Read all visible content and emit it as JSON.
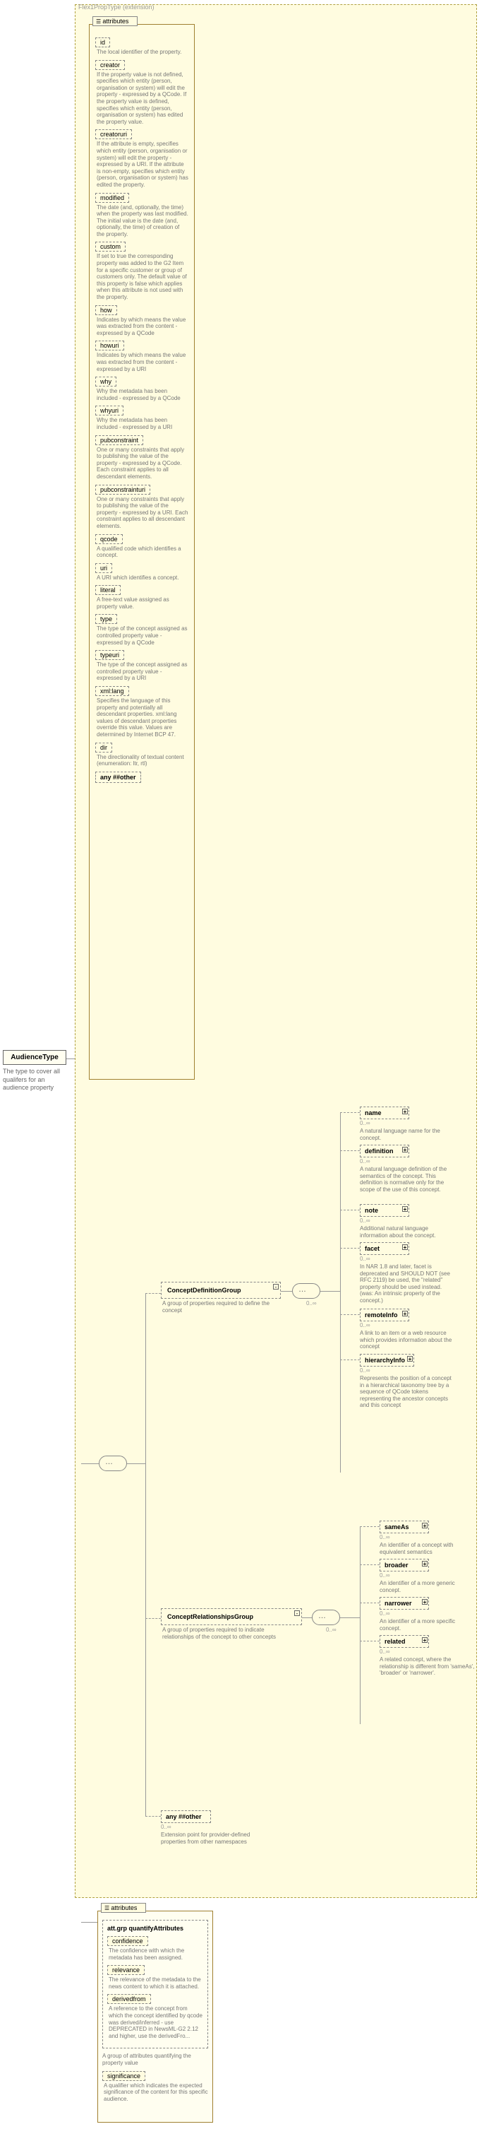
{
  "ext_label": "Flex1PropType (extension)",
  "root": {
    "name": "AudienceType",
    "desc": "The type to cover all qualifers for an audience property"
  },
  "attr_header": "attributes",
  "attrs": [
    {
      "name": "id",
      "desc": "The local identifier of the property."
    },
    {
      "name": "creator",
      "desc": "If the property value is not defined, specifies which entity (person, organisation or system) will edit the property - expressed by a QCode. If the property value is defined, specifies which entity (person, organisation or system) has edited the property value."
    },
    {
      "name": "creatoruri",
      "desc": "If the attribute is empty, specifies which entity (person, organisation or system) will edit the property - expressed by a URI. If the attribute is non-empty, specifies which entity (person, organisation or system) has edited the property."
    },
    {
      "name": "modified",
      "desc": "The date (and, optionally, the time) when the property was last modified. The initial value is the date (and, optionally, the time) of creation of the property."
    },
    {
      "name": "custom",
      "desc": "If set to true the corresponding property was added to the G2 Item for a specific customer or group of customers only. The default value of this property is false which applies when this attribute is not used with the property."
    },
    {
      "name": "how",
      "desc": "Indicates by which means the value was extracted from the content - expressed by a QCode"
    },
    {
      "name": "howuri",
      "desc": "Indicates by which means the value was extracted from the content - expressed by a URI"
    },
    {
      "name": "why",
      "desc": "Why the metadata has been included - expressed by a QCode"
    },
    {
      "name": "whyuri",
      "desc": "Why the metadata has been included - expressed by a URI"
    },
    {
      "name": "pubconstraint",
      "desc": "One or many constraints that apply to publishing the value of the property - expressed by a QCode. Each constraint applies to all descendant elements."
    },
    {
      "name": "pubconstrainturi",
      "desc": "One or many constraints that apply to publishing the value of the property - expressed by a URI. Each constraint applies to all descendant elements."
    },
    {
      "name": "qcode",
      "desc": "A qualified code which identifies a concept."
    },
    {
      "name": "uri",
      "desc": "A URI which identifies a concept."
    },
    {
      "name": "literal",
      "desc": "A free-text value assigned as property value."
    },
    {
      "name": "type",
      "desc": "The type of the concept assigned as controlled property value - expressed by a QCode"
    },
    {
      "name": "typeuri",
      "desc": "The type of the concept assigned as controlled property value - expressed by a URI"
    },
    {
      "name": "xml:lang",
      "desc": "Specifies the language of this property and potentially all descendant properties. xml:lang values of descendant properties override this value. Values are determined by Internet BCP 47."
    },
    {
      "name": "dir",
      "desc": "The directionality of textual content (enumeration: ltr, rtl)"
    }
  ],
  "any_other": "any ##other",
  "grp_def": {
    "title": "ConceptDefinitionGroup",
    "desc": "A group of properties required to define the concept"
  },
  "grp_rel": {
    "title": "ConceptRelationshipsGroup",
    "desc": "A group of properties required to indicate relationships of the concept to other concepts"
  },
  "any_ext": {
    "label": "any ##other",
    "card": "0..∞",
    "desc": "Extension point for provider-defined properties from other namespaces"
  },
  "def_children": [
    {
      "name": "name",
      "card": "0..∞",
      "desc": "A natural language name for the concept."
    },
    {
      "name": "definition",
      "card": "0..∞",
      "desc": "A natural language definition of the semantics of the concept. This definition is normative only for the scope of the use of this concept."
    },
    {
      "name": "note",
      "card": "0..∞",
      "desc": "Additional natural language information about the concept."
    },
    {
      "name": "facet",
      "card": "0..∞",
      "desc": "In NAR 1.8 and later, facet is deprecated and SHOULD NOT (see RFC 2119) be used, the \"related\" property should be used instead. (was: An intrinsic property of the concept.)"
    },
    {
      "name": "remoteInfo",
      "card": "0..∞",
      "desc": "A link to an item or a web resource which provides information about the concept"
    },
    {
      "name": "hierarchyInfo",
      "card": "0..∞",
      "desc": "Represents the position of a concept in a hierarchical taxonomy tree by a sequence of QCode tokens representing the ancestor concepts and this concept"
    }
  ],
  "rel_children": [
    {
      "name": "sameAs",
      "card": "0..∞",
      "desc": "An identifier of a concept with equivalent semantics"
    },
    {
      "name": "broader",
      "card": "0..∞",
      "desc": "An identifier of a more generic concept."
    },
    {
      "name": "narrower",
      "card": "0..∞",
      "desc": "An identifier of a more specific concept."
    },
    {
      "name": "related",
      "card": "0..∞",
      "desc": "A related concept, where the relationship is different from 'sameAs', 'broader' or 'narrower'."
    }
  ],
  "lower": {
    "hdr": "attributes",
    "grp_title": "att.grp  quantifyAttributes",
    "attrs": [
      {
        "name": "confidence",
        "desc": "The confidence with which the metadata has been assigned."
      },
      {
        "name": "relevance",
        "desc": "The relevance of the metadata to the news content to which it is attached."
      },
      {
        "name": "derivedfrom",
        "desc": "A reference to the concept from which the concept identified by qcode was derived/inferred - use DEPRECATED in NewsML-G2 2.12 and higher, use the derivedFro..."
      }
    ],
    "grp_desc": "A group of attributes quantifying the property value",
    "sig": {
      "name": "significance",
      "desc": "A qualifier which indicates the expected significance of the content for this specific audience."
    }
  }
}
